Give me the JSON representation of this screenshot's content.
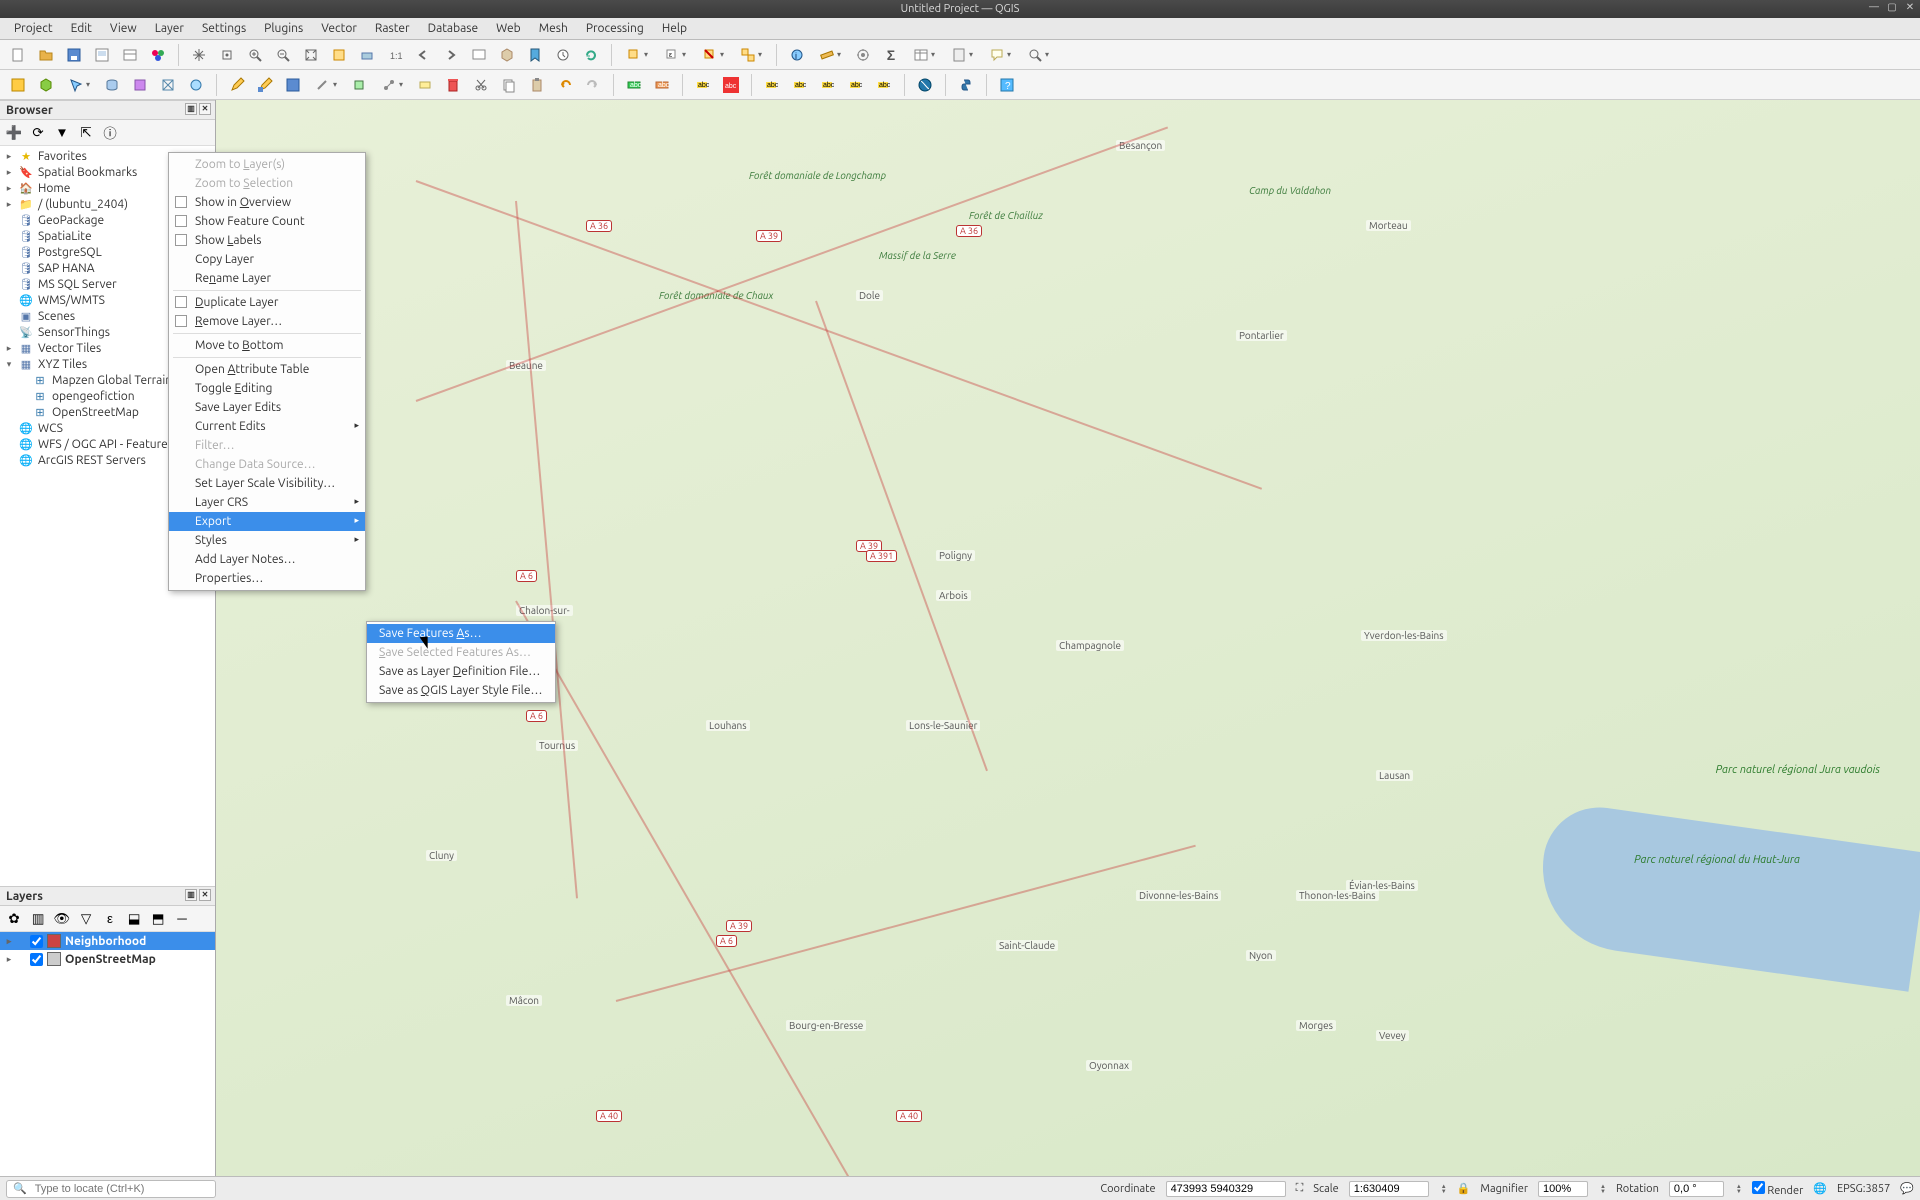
{
  "title": "Untitled Project — QGIS",
  "menus": [
    "Project",
    "Edit",
    "View",
    "Layer",
    "Settings",
    "Plugins",
    "Vector",
    "Raster",
    "Database",
    "Web",
    "Mesh",
    "Processing",
    "Help"
  ],
  "browser": {
    "title": "Browser",
    "items": [
      {
        "label": "Favorites",
        "icon": "star",
        "color": "#e6b800",
        "expand": "▸"
      },
      {
        "label": "Spatial Bookmarks",
        "icon": "bookmark",
        "expand": "▸"
      },
      {
        "label": "Home",
        "icon": "home",
        "expand": "▸"
      },
      {
        "label": "/ (lubuntu_2404)",
        "icon": "folder",
        "expand": "▸"
      },
      {
        "label": "GeoPackage",
        "icon": "db"
      },
      {
        "label": "SpatiaLite",
        "icon": "db"
      },
      {
        "label": "PostgreSQL",
        "icon": "db"
      },
      {
        "label": "SAP HANA",
        "icon": "db"
      },
      {
        "label": "MS SQL Server",
        "icon": "db"
      },
      {
        "label": "WMS/WMTS",
        "icon": "globe"
      },
      {
        "label": "Scenes",
        "icon": "cube"
      },
      {
        "label": "SensorThings",
        "icon": "sensor"
      },
      {
        "label": "Vector Tiles",
        "icon": "tile",
        "expand": "▸"
      },
      {
        "label": "XYZ Tiles",
        "icon": "grid",
        "expand": "▾",
        "children": [
          {
            "label": "Mapzen Global Terrain",
            "icon": "gridb"
          },
          {
            "label": "opengeofiction",
            "icon": "gridb"
          },
          {
            "label": "OpenStreetMap",
            "icon": "gridb"
          }
        ]
      },
      {
        "label": "WCS",
        "icon": "globe"
      },
      {
        "label": "WFS / OGC API - Features",
        "icon": "globe"
      },
      {
        "label": "ArcGIS REST Servers",
        "icon": "globe"
      }
    ]
  },
  "layers": {
    "title": "Layers",
    "items": [
      {
        "label": "Neighborhood",
        "checked": true,
        "selected": true,
        "color": "#c44"
      },
      {
        "label": "OpenStreetMap",
        "checked": true,
        "selected": false
      }
    ]
  },
  "context_menu": {
    "items": [
      {
        "label": "Zoom to Layer(s)",
        "disabled": true,
        "underline": "L"
      },
      {
        "label": "Zoom to Selection",
        "disabled": true,
        "underline": "S"
      },
      {
        "label": "Show in Overview",
        "check": true,
        "underline": "O"
      },
      {
        "label": "Show Feature Count",
        "check": true
      },
      {
        "label": "Show Labels",
        "check": true,
        "underline": "L"
      },
      {
        "label": "Copy Layer"
      },
      {
        "label": "Rename Layer",
        "underline": "n"
      },
      {
        "sep": true
      },
      {
        "label": "Duplicate Layer",
        "check": true,
        "underline": "D"
      },
      {
        "label": "Remove Layer…",
        "check": true,
        "underline": "R"
      },
      {
        "sep": true
      },
      {
        "label": "Move to Bottom",
        "underline": "B"
      },
      {
        "sep": true
      },
      {
        "label": "Open Attribute Table",
        "underline": "A"
      },
      {
        "label": "Toggle Editing",
        "underline": "E"
      },
      {
        "label": "Save Layer Edits"
      },
      {
        "label": "Current Edits",
        "submenu": true
      },
      {
        "label": "Filter…",
        "disabled": true
      },
      {
        "label": "Change Data Source…",
        "disabled": true
      },
      {
        "label": "Set Layer Scale Visibility…"
      },
      {
        "label": "Layer CRS",
        "submenu": true
      },
      {
        "label": "Export",
        "submenu": true,
        "hl": true
      },
      {
        "label": "Styles",
        "submenu": true
      },
      {
        "label": "Add Layer Notes…"
      },
      {
        "label": "Properties…"
      }
    ]
  },
  "export_submenu": [
    {
      "label": "Save Features As…",
      "hl": true,
      "underline": "A"
    },
    {
      "label": "Save Selected Features As…",
      "disabled": true,
      "underline": "S"
    },
    {
      "label": "Save as Layer Definition File…",
      "underline": "D"
    },
    {
      "label": "Save as QGIS Layer Style File…",
      "underline": "Q"
    }
  ],
  "map": {
    "places": [
      "Besançon",
      "Dole",
      "Beaune",
      "Chalon-sur-",
      "Tournus",
      "Mâcon",
      "Bourg-en-Bresse",
      "Lons-le-Saunier",
      "Champagnole",
      "Pontarlier",
      "Oyonnax",
      "Cluny",
      "Poligny",
      "Louhans",
      "Morteau",
      "Évian-les-Bains",
      "Lausan",
      "Thonon-les-Bains",
      "Divonne-les-Bains",
      "Saint-Claude",
      "Nyon",
      "Yverdon-les-Bains",
      "Vevey",
      "Morges",
      "Arbois"
    ],
    "shields": [
      "A 36",
      "A 36",
      "A 39",
      "A 391",
      "A 39",
      "A 6",
      "A 6",
      "A 6",
      "A 39",
      "A 40",
      "A 40"
    ],
    "parks": [
      "Parc naturel régional du Haut-Jura",
      "Parc naturel régional Jura vaudois"
    ],
    "forests": [
      "Forêt domaniale de Chaux",
      "Forêt de Chailluz",
      "Forêt domaniale de Longchamp",
      "Massif de la Serre",
      "Camp du Valdahon"
    ]
  },
  "status": {
    "locator_placeholder": "Type to locate (Ctrl+K)",
    "coord_label": "Coordinate",
    "coord_value": "473993 5940329",
    "scale_label": "Scale",
    "scale_value": "1:630409",
    "magnifier_label": "Magnifier",
    "magnifier_value": "100%",
    "rotation_label": "Rotation",
    "rotation_value": "0,0 °",
    "render_label": "Render",
    "crs_label": "EPSG:3857"
  }
}
